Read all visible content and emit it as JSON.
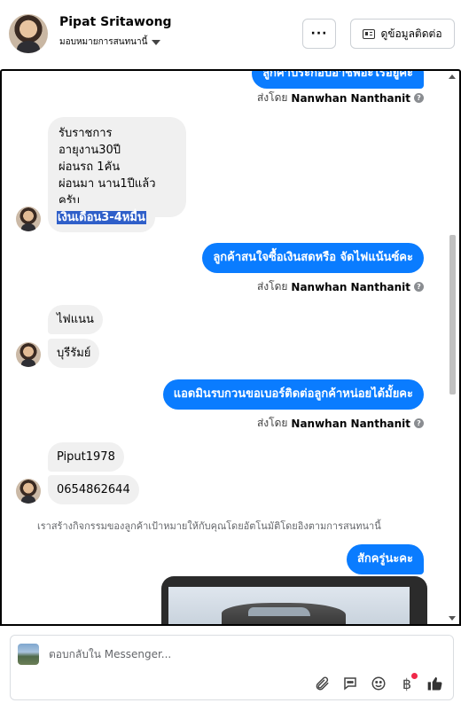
{
  "header": {
    "name": "Pipat Sritawong",
    "assign_label": "มอบหมายการสนทนานี้",
    "more_label": "···",
    "contact_button_label": "ดูข้อมูลติดต่อ"
  },
  "chat": {
    "top_partial_message": "ลูกค้าประกอบอาชีพอะไรอยู่คะ",
    "sent_by_prefix": "ส่งโดย",
    "sender_name": "Nanwhan Nanthanit",
    "incoming_block_1": {
      "line1": "รับราชการ",
      "line2": "อายุงาน30ปี",
      "line3": "ผ่อนรถ 1คัน",
      "line4": "ผ่อนมา นาน1ปีแล้วครับ"
    },
    "incoming_selected": "เงินเดือน3-4หมื่น",
    "outgoing_1": "ลูกค้าสนใจซื้อเงินสดหรือ จัดไฟแน้นซ์คะ",
    "incoming_2a": "ไฟแนน",
    "incoming_2b": "บุรีรัมย์",
    "outgoing_2": "แอดมินรบกวนขอเบอร์ติดต่อลูกค้าหน่อยได้มั้ยคะ",
    "incoming_3a": "Piput1978",
    "incoming_3b": "0654862644",
    "system_note": "เราสร้างกิจกรรมของลูกค้าเป้าหมายให้กับคุณโดยอัตโนมัติโดยอิงตามการสนทนานี้",
    "outgoing_3": "สักครู่นะคะ"
  },
  "composer": {
    "placeholder": "ตอบกลับใน Messenger..."
  },
  "icons": {
    "attach": "paperclip-icon",
    "saved_reply": "chat-bubble-icon",
    "emoji": "smiley-icon",
    "payment": "baht-icon",
    "like": "thumbs-up-icon"
  },
  "colors": {
    "outgoing_bubble": "#0a7cff",
    "incoming_bubble": "#f0f0f0",
    "selection": "#2f5fc9",
    "notification_dot": "#f02849"
  }
}
